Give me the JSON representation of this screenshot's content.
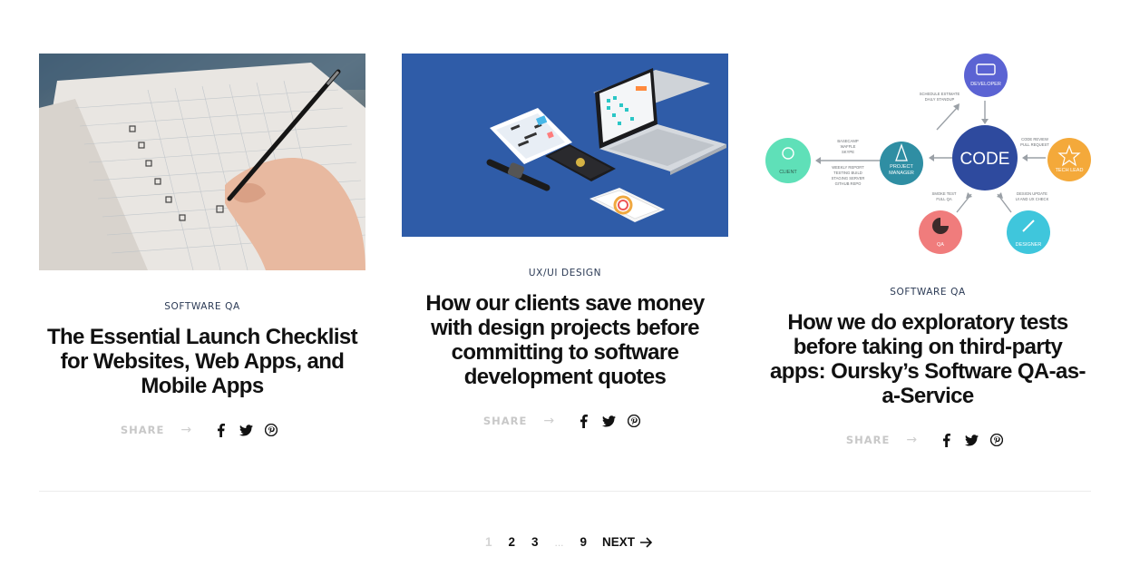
{
  "posts": [
    {
      "category": "SOFTWARE QA",
      "title_lines": [
        "The Essential Launch Checklist",
        "for Websites, Web Apps, and",
        "Mobile Apps"
      ],
      "share_label": "SHARE"
    },
    {
      "category": "UX/UI DESIGN",
      "title_lines": [
        "How our clients save money",
        "with design projects before",
        "committing to software",
        "development quotes"
      ],
      "share_label": "SHARE"
    },
    {
      "category": "SOFTWARE QA",
      "title_lines": [
        "How we do exploratory tests",
        "before taking on third-party",
        "apps: Oursky’s Software QA-as-",
        "a-Service"
      ],
      "share_label": "SHARE"
    }
  ],
  "diagram": {
    "center": "CODE",
    "nodes": {
      "developer": "DEVELOPER",
      "client": "CLIENT",
      "pm_line1": "PROJECT",
      "pm_line2": "MANAGER",
      "tech_lead": "TECH LEAD",
      "qa": "QA",
      "designer": "DESIGNER"
    },
    "notes": {
      "left_top": [
        "BASECAMP",
        "WAFFLE",
        "SKYPE"
      ],
      "left_bottom": [
        "WEEKLY REPORT",
        "TESTING BUILD",
        "STAGING SERVER",
        "GITHUB REPO"
      ],
      "top": [
        "SCHEDULE ESTIMATE",
        "DAILY STANDUP"
      ],
      "right": [
        "CODE REVIEW",
        "PULL REQUEST"
      ],
      "bottom_left": [
        "SMOKE TEST",
        "FULL QA"
      ],
      "bottom_right": [
        "DESIGN UPDATE",
        "UI AND UX CHECK"
      ]
    },
    "colors": {
      "code": "#2e4a9e",
      "developer": "#5b63d3",
      "client": "#5fe0b8",
      "pm": "#2f8ea3",
      "tech_lead": "#f4a93a",
      "qa": "#f07c7c",
      "designer": "#3fc6dc"
    }
  },
  "pagination": {
    "current": "1",
    "pages": [
      "2",
      "3"
    ],
    "ellipsis": "...",
    "last": "9",
    "next_label": "NEXT"
  }
}
